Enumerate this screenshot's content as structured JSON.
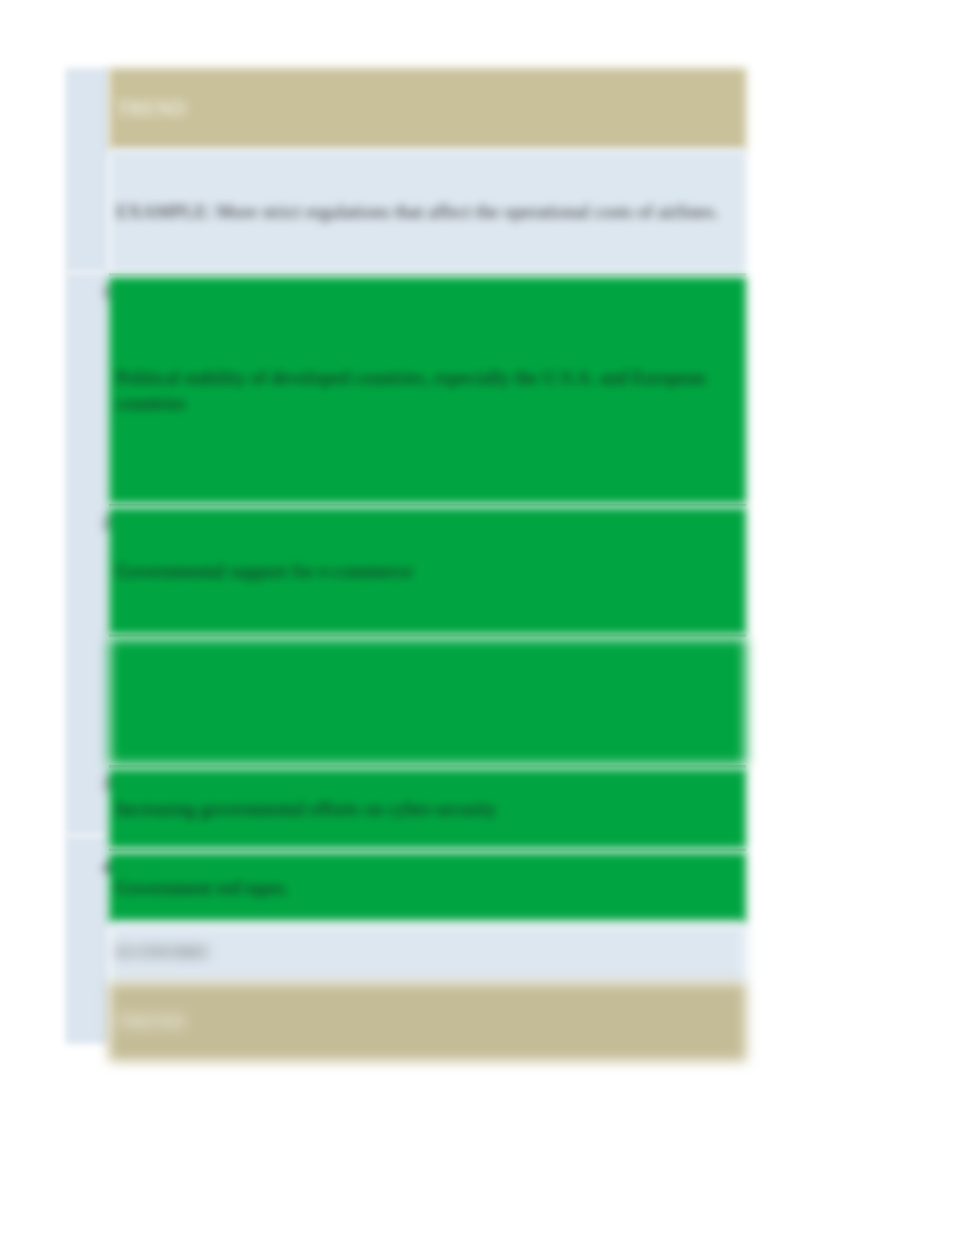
{
  "section1": {
    "header": "TREND",
    "example": "EXAMPLE: More strict regulations that affect the operational costs of airlines.",
    "rows": [
      {
        "num": "1",
        "text": "Political stability of developed countries, especially the U.S.A. and European countries"
      },
      {
        "num": "2",
        "text": "Governmental support for e-commerce"
      },
      {
        "num": "",
        "text": ""
      },
      {
        "num": "3",
        "text": "Increasing governmental efforts on cyber-security"
      },
      {
        "num": "4",
        "text": "Government red tapes."
      }
    ]
  },
  "section2": {
    "label": "ECONOMIC",
    "header": "TREND"
  }
}
